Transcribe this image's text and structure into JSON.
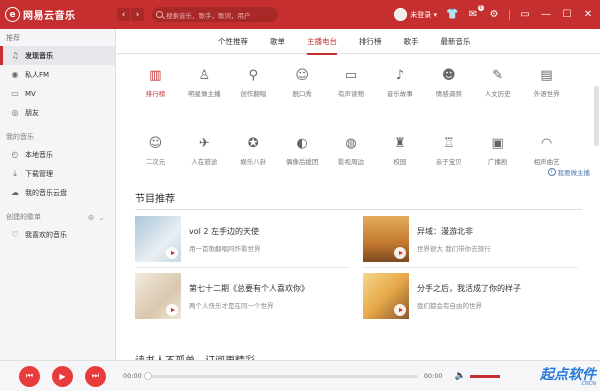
{
  "app": {
    "title": "网易云音乐"
  },
  "search": {
    "placeholder": "搜索音乐，歌手，歌词，用户"
  },
  "header": {
    "login": "未登录 ▾",
    "badge": "6"
  },
  "sidebar": {
    "sections": [
      {
        "title": "推荐",
        "items": [
          {
            "icon": "♫",
            "label": "发现音乐"
          },
          {
            "icon": "◉",
            "label": "私人FM"
          },
          {
            "icon": "▭",
            "label": "MV"
          },
          {
            "icon": "◎",
            "label": "朋友"
          }
        ]
      },
      {
        "title": "我的音乐",
        "items": [
          {
            "icon": "◴",
            "label": "本地音乐"
          },
          {
            "icon": "⤓",
            "label": "下载管理"
          },
          {
            "icon": "☁",
            "label": "我的音乐云盘"
          }
        ]
      },
      {
        "title": "创建的歌单",
        "items": [
          {
            "icon": "♡",
            "label": "我喜欢的音乐"
          }
        ]
      }
    ]
  },
  "tabs": [
    "个性推荐",
    "歌单",
    "主播电台",
    "排行榜",
    "歌手",
    "最新音乐"
  ],
  "categories_row1": [
    {
      "icon": "▥",
      "label": "排行榜"
    },
    {
      "icon": "♙",
      "label": "明星做主播"
    },
    {
      "icon": "⚲",
      "label": "创作翻唱"
    },
    {
      "icon": "☺",
      "label": "脱口秀"
    },
    {
      "icon": "▭",
      "label": "有声读物"
    },
    {
      "icon": "♪",
      "label": "音乐故事"
    },
    {
      "icon": "☻",
      "label": "情感调频"
    },
    {
      "icon": "✎",
      "label": "人文历史"
    },
    {
      "icon": "▤",
      "label": "外语世界"
    }
  ],
  "categories_row2": [
    {
      "icon": "☺",
      "label": "二次元"
    },
    {
      "icon": "✈",
      "label": "人在旅途"
    },
    {
      "icon": "✪",
      "label": "娱乐八卦"
    },
    {
      "icon": "◐",
      "label": "偶像后援团"
    },
    {
      "icon": "◍",
      "label": "影视周边"
    },
    {
      "icon": "♜",
      "label": "校园"
    },
    {
      "icon": "♖",
      "label": "亲子宝贝"
    },
    {
      "icon": "▣",
      "label": "广播剧"
    },
    {
      "icon": "◠",
      "label": "相声曲艺"
    }
  ],
  "link_right": "我要做主播",
  "section_title": "节目推荐",
  "programs": [
    {
      "title": "vol 2 左手边的天使",
      "sub": "用一首歌翻唱阿炸看世界"
    },
    {
      "title": "异域：漫游北非",
      "sub": "世界很大 我们带你去旅行"
    },
    {
      "title": "第七十二期《总要有个人喜欢你》",
      "sub": "两个人快乐才是在同一个世界"
    },
    {
      "title": "分手之后，我活成了你的样子",
      "sub": "我们都会有自由的世界"
    }
  ],
  "bottom_title": "读书人不孤单 - 订阅更精彩",
  "player": {
    "time_current": "00:00",
    "time_total": "00:00",
    "progress": 0
  },
  "watermark": "起点软件",
  "watermark_sub": ".CNCN",
  "colors": {
    "accent": "#c62f2f"
  }
}
